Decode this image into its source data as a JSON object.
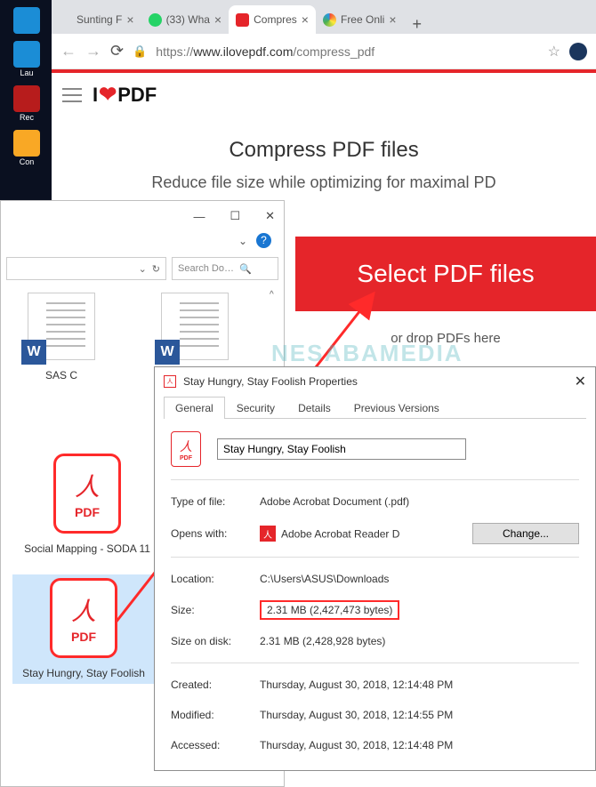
{
  "desktop": {
    "items": [
      {
        "label": ""
      },
      {
        "label": "Lau"
      },
      {
        "label": "Rec"
      },
      {
        "label": "Con"
      }
    ]
  },
  "browser": {
    "tabs": [
      {
        "title": "Sunting F",
        "color": "#5b8def"
      },
      {
        "title": "(33) Wha",
        "color": "#25d366"
      },
      {
        "title": "Compres",
        "color": "#e5252a"
      },
      {
        "title": "Free Onli",
        "color": "#8e44ad"
      }
    ],
    "url_prefix": "https://",
    "url_host": "www.ilovepdf.com",
    "url_path": "/compress_pdf",
    "logo_a": "I",
    "logo_b": "PDF",
    "heading": "Compress PDF files",
    "subheading": "Reduce file size while optimizing for maximal PD",
    "select_btn": "Select PDF files",
    "drop_text": "or drop PDFs here"
  },
  "explorer": {
    "search_placeholder": "Search Do…",
    "files": {
      "word1": "SAS C",
      "word2": "",
      "pdf1": "Social Mapping - SODA 11",
      "pdf2": "Stay Hungry, Stay Foolish"
    }
  },
  "props": {
    "title": "Stay Hungry, Stay Foolish Properties",
    "tabs": [
      "General",
      "Security",
      "Details",
      "Previous Versions"
    ],
    "filename": "Stay Hungry, Stay Foolish",
    "rows": {
      "type_l": "Type of file:",
      "type_v": "Adobe Acrobat Document (.pdf)",
      "opens_l": "Opens with:",
      "opens_v": "Adobe Acrobat Reader D",
      "change": "Change...",
      "loc_l": "Location:",
      "loc_v": "C:\\Users\\ASUS\\Downloads",
      "size_l": "Size:",
      "size_v": "2.31 MB (2,427,473 bytes)",
      "disk_l": "Size on disk:",
      "disk_v": "2.31 MB (2,428,928 bytes)",
      "created_l": "Created:",
      "created_v": "Thursday, August 30, 2018, 12:14:48 PM",
      "modified_l": "Modified:",
      "modified_v": "Thursday, August 30, 2018, 12:14:55 PM",
      "accessed_l": "Accessed:",
      "accessed_v": "Thursday, August 30, 2018, 12:14:48 PM"
    }
  },
  "watermark": {
    "a": "NESABAMEDIA"
  }
}
